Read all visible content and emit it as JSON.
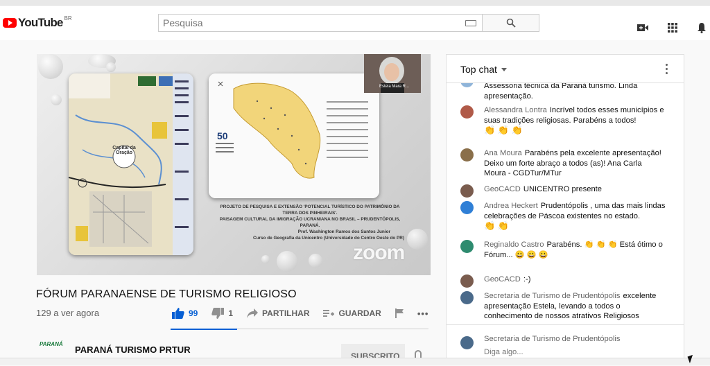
{
  "header": {
    "logo_text": "YouTube",
    "country_code": "BR",
    "search_placeholder": "Pesquisa"
  },
  "video": {
    "title": "FÓRUM PARANAENSE DE TURISMO RELIGIOSO",
    "views": "129 a ver agora",
    "likes": "99",
    "dislikes": "1",
    "share_label": "PARTILHAR",
    "save_label": "GUARDAR",
    "more_label": "•••",
    "presenter_name": "Estela Mara R...",
    "overlay_brand": "zoom",
    "slide_caption": [
      "PROJETO DE PESQUISA E EXTENSÃO 'POTENCIAL TURÍSTICO DO PATRIMÔNIO DA",
      "TERRA DOS PINHEIRAIS'.",
      "PAISAGEM CULTURAL DA IMIGRAÇÃO UCRANIANA NO BRASIL – PRUDENTÓPOLIS,",
      "PARANÁ.",
      "Prof. Washington Ramos dos Santos Junior",
      "Curso de Geografia da Unicentro (Universidade do Centro Oeste do PR)"
    ],
    "slide_map_label": "Capital da Oração",
    "slide_badge": "50"
  },
  "channel": {
    "name": "PARANÁ TURISMO PRTUR",
    "logo_text": "PARANÁ",
    "subscribe_label": "SUBSCRITO"
  },
  "chat": {
    "header": "Top chat",
    "messages": [
      {
        "author": "",
        "text": "Assessoria técnica da Paraná turismo. Linda apresentação.",
        "emoji": "",
        "avatar_color": "#8fb4d9"
      },
      {
        "author": "Alessandra Lontra",
        "text": "Incrível todos esses municípios e suas tradições religiosas. Parabéns a todos!",
        "emoji": "👏 👏 👏",
        "avatar_color": "#b05a48"
      },
      {
        "author": "Ana Moura",
        "text": "Parabéns pela excelente apresentação! Deixo um forte abraço a todos (as)! Ana Carla Moura - CGDTur/MTur",
        "emoji": "",
        "avatar_color": "#8a6f4a"
      },
      {
        "author": "GeoCACD",
        "text": "UNICENTRO presente",
        "emoji": "",
        "avatar_color": "#7a5c4e"
      },
      {
        "author": "Andrea Heckert",
        "text": "Prudentópolis , uma das mais lindas celebrações de Páscoa existentes no estado.",
        "emoji": "👏 👏",
        "avatar_color": "#2f7fd6"
      },
      {
        "author": "Reginaldo Castro",
        "text": "Parabéns. 👏 👏 👏 Está ótimo o Fórum... 😀 😀 😀",
        "emoji": "",
        "avatar_color": "#2e8b6f"
      },
      {
        "author": "GeoCACD",
        "text": ":-)",
        "emoji": "",
        "avatar_color": "#7a5c4e"
      },
      {
        "author": "Secretaria de Turismo de Prudentópolis",
        "text": "excelente apresentação Estela, levando a todos o conhecimento de nossos atrativos Religiosos",
        "emoji": "",
        "avatar_color": "#4a6a8a"
      }
    ],
    "footer_author": "Secretaria de Turismo de Prudentópolis",
    "input_placeholder": "Diga algo..."
  }
}
